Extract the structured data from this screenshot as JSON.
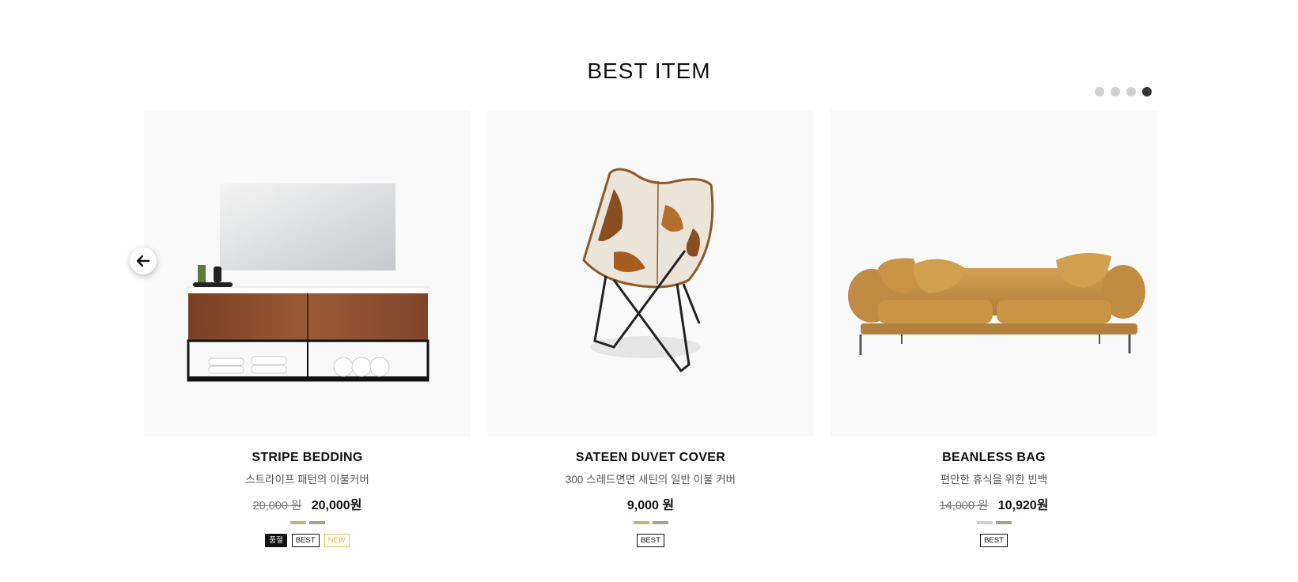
{
  "section": {
    "title": "BEST ITEM"
  },
  "pager": {
    "count": 4,
    "active_index": 3
  },
  "products": [
    {
      "image": "bathroom-vanity-image",
      "name": "STRIPE BEDDING",
      "description": "스트라이프 패턴의 이불커버",
      "original_price": "20,000 원",
      "price": "20,000원",
      "colors": [
        "#c9b46f",
        "#a3a392"
      ],
      "badges": [
        {
          "text": "품절",
          "style": "dark"
        },
        {
          "text": "BEST",
          "style": "light"
        },
        {
          "text": "NEW",
          "style": "gold"
        }
      ]
    },
    {
      "image": "butterfly-chair-image",
      "name": "SATEEN DUVET COVER",
      "description": "300 스레드면면 새틴의 일반 이불 커버",
      "original_price": "",
      "price": "9,000 원",
      "colors": [
        "#c9b46f",
        "#a3a392"
      ],
      "badges": [
        {
          "text": "BEST",
          "style": "light"
        }
      ]
    },
    {
      "image": "leather-sofa-image",
      "name": "BEANLESS BAG",
      "description": "편안한 휴식을 위한 빈백",
      "original_price": "14,000 원",
      "price": "10,920원",
      "colors": [
        "#cfcfcc",
        "#a3a382"
      ],
      "badges": [
        {
          "text": "BEST",
          "style": "light"
        }
      ]
    }
  ]
}
